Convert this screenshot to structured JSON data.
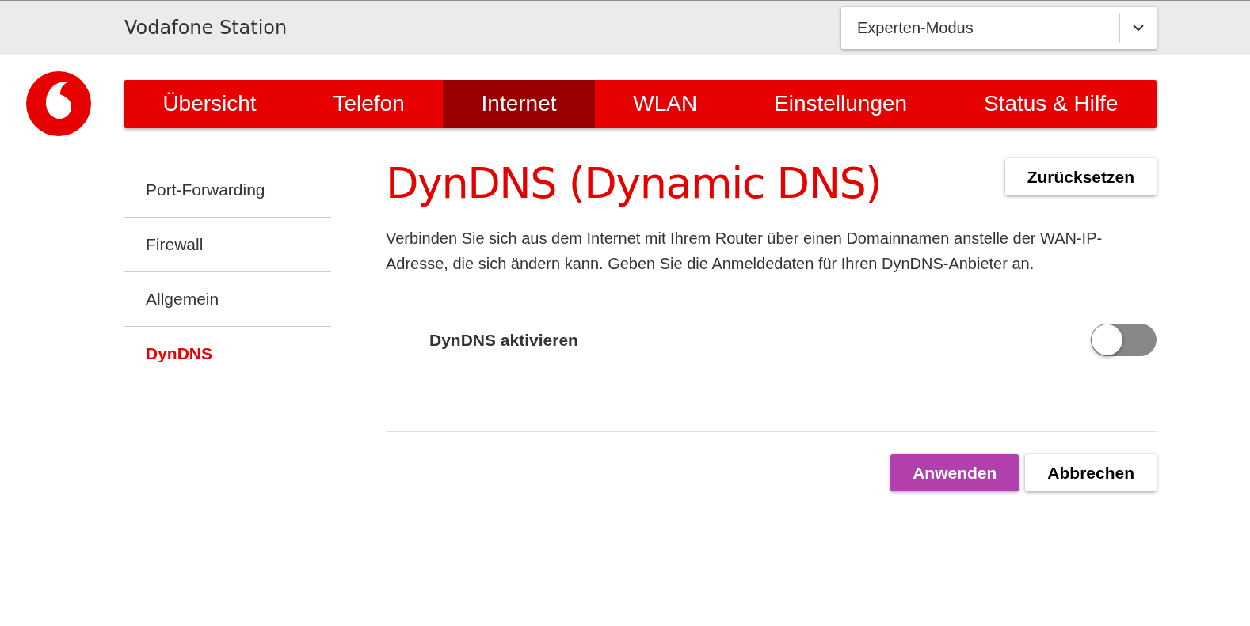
{
  "header": {
    "title": "Vodafone Station",
    "mode_select": {
      "value": "Experten-Modus"
    }
  },
  "nav": [
    {
      "label": "Übersicht",
      "selected": false
    },
    {
      "label": "Telefon",
      "selected": false
    },
    {
      "label": "Internet",
      "selected": true
    },
    {
      "label": "WLAN",
      "selected": false
    },
    {
      "label": "Einstellungen",
      "selected": false
    },
    {
      "label": "Status & Hilfe",
      "selected": false
    }
  ],
  "sidebar": {
    "items": [
      {
        "label": "Port-Forwarding",
        "selected": false
      },
      {
        "label": "Firewall",
        "selected": false
      },
      {
        "label": "Allgemein",
        "selected": false
      },
      {
        "label": "DynDNS",
        "selected": true
      }
    ]
  },
  "content": {
    "heading": "DynDNS (Dynamic DNS)",
    "reset_button": "Zurücksetzen",
    "description": "Verbinden Sie sich aus dem Internet mit Ihrem Router über einen Domainnamen anstelle der WAN-IP-Adresse, die sich ändern kann. Geben Sie die Anmeldedaten für Ihren DynDNS-Anbieter an.",
    "toggle": {
      "label": "DynDNS aktivieren",
      "on": false
    },
    "buttons": [
      {
        "label": "Anwenden",
        "kind": "primary"
      },
      {
        "label": "Abbrechen",
        "kind": "secondary"
      }
    ]
  }
}
